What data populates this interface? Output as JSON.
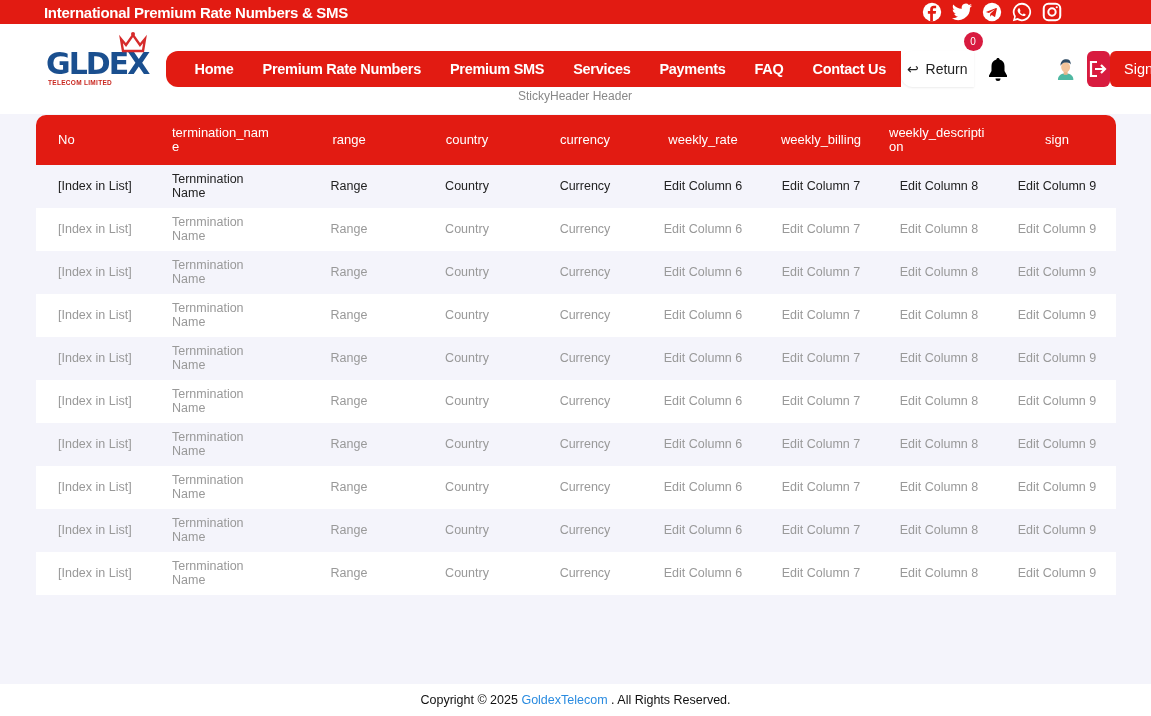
{
  "top_bar": {
    "title": "International Premium Rate Numbers & SMS"
  },
  "logo": {
    "left": "G",
    "right": "LDEX",
    "tagline": "TELECOM LIMITED"
  },
  "nav": [
    {
      "label": "Home"
    },
    {
      "label": "Premium Rate Numbers"
    },
    {
      "label": "Premium SMS"
    },
    {
      "label": "Services"
    },
    {
      "label": "Payments"
    },
    {
      "label": "FAQ"
    },
    {
      "label": "Contact Us"
    }
  ],
  "return_button": {
    "icon": "↩",
    "label": "Return"
  },
  "notifications": {
    "count": "0"
  },
  "sign_button": {
    "label": "Sign"
  },
  "header_caption": "StickyHeader Header",
  "table": {
    "columns": [
      "No",
      "termination_name",
      "range",
      "country",
      "currency",
      "weekly_rate",
      "weekly_billing",
      "weekly_description",
      "sign"
    ],
    "rows": [
      {
        "dimmed": false,
        "cells": [
          "[Index in List]",
          "Ternmination Name",
          "Range",
          "Country",
          "Currency",
          "Edit Column 6",
          "Edit Column 7",
          "Edit Column 8",
          "Edit Column 9"
        ]
      },
      {
        "dimmed": true,
        "cells": [
          "[Index in List]",
          "Ternmination Name",
          "Range",
          "Country",
          "Currency",
          "Edit Column 6",
          "Edit Column 7",
          "Edit Column 8",
          "Edit Column 9"
        ]
      },
      {
        "dimmed": true,
        "cells": [
          "[Index in List]",
          "Ternmination Name",
          "Range",
          "Country",
          "Currency",
          "Edit Column 6",
          "Edit Column 7",
          "Edit Column 8",
          "Edit Column 9"
        ]
      },
      {
        "dimmed": true,
        "cells": [
          "[Index in List]",
          "Ternmination Name",
          "Range",
          "Country",
          "Currency",
          "Edit Column 6",
          "Edit Column 7",
          "Edit Column 8",
          "Edit Column 9"
        ]
      },
      {
        "dimmed": true,
        "cells": [
          "[Index in List]",
          "Ternmination Name",
          "Range",
          "Country",
          "Currency",
          "Edit Column 6",
          "Edit Column 7",
          "Edit Column 8",
          "Edit Column 9"
        ]
      },
      {
        "dimmed": true,
        "cells": [
          "[Index in List]",
          "Ternmination Name",
          "Range",
          "Country",
          "Currency",
          "Edit Column 6",
          "Edit Column 7",
          "Edit Column 8",
          "Edit Column 9"
        ]
      },
      {
        "dimmed": true,
        "cells": [
          "[Index in List]",
          "Ternmination Name",
          "Range",
          "Country",
          "Currency",
          "Edit Column 6",
          "Edit Column 7",
          "Edit Column 8",
          "Edit Column 9"
        ]
      },
      {
        "dimmed": true,
        "cells": [
          "[Index in List]",
          "Ternmination Name",
          "Range",
          "Country",
          "Currency",
          "Edit Column 6",
          "Edit Column 7",
          "Edit Column 8",
          "Edit Column 9"
        ]
      },
      {
        "dimmed": true,
        "cells": [
          "[Index in List]",
          "Ternmination Name",
          "Range",
          "Country",
          "Currency",
          "Edit Column 6",
          "Edit Column 7",
          "Edit Column 8",
          "Edit Column 9"
        ]
      },
      {
        "dimmed": true,
        "cells": [
          "[Index in List]",
          "Ternmination Name",
          "Range",
          "Country",
          "Currency",
          "Edit Column 6",
          "Edit Column 7",
          "Edit Column 8",
          "Edit Column 9"
        ]
      }
    ]
  },
  "footer": {
    "before": "Copyright © 2025",
    "link": "GoldexTelecom",
    "after": ". All Rights Reserved."
  }
}
